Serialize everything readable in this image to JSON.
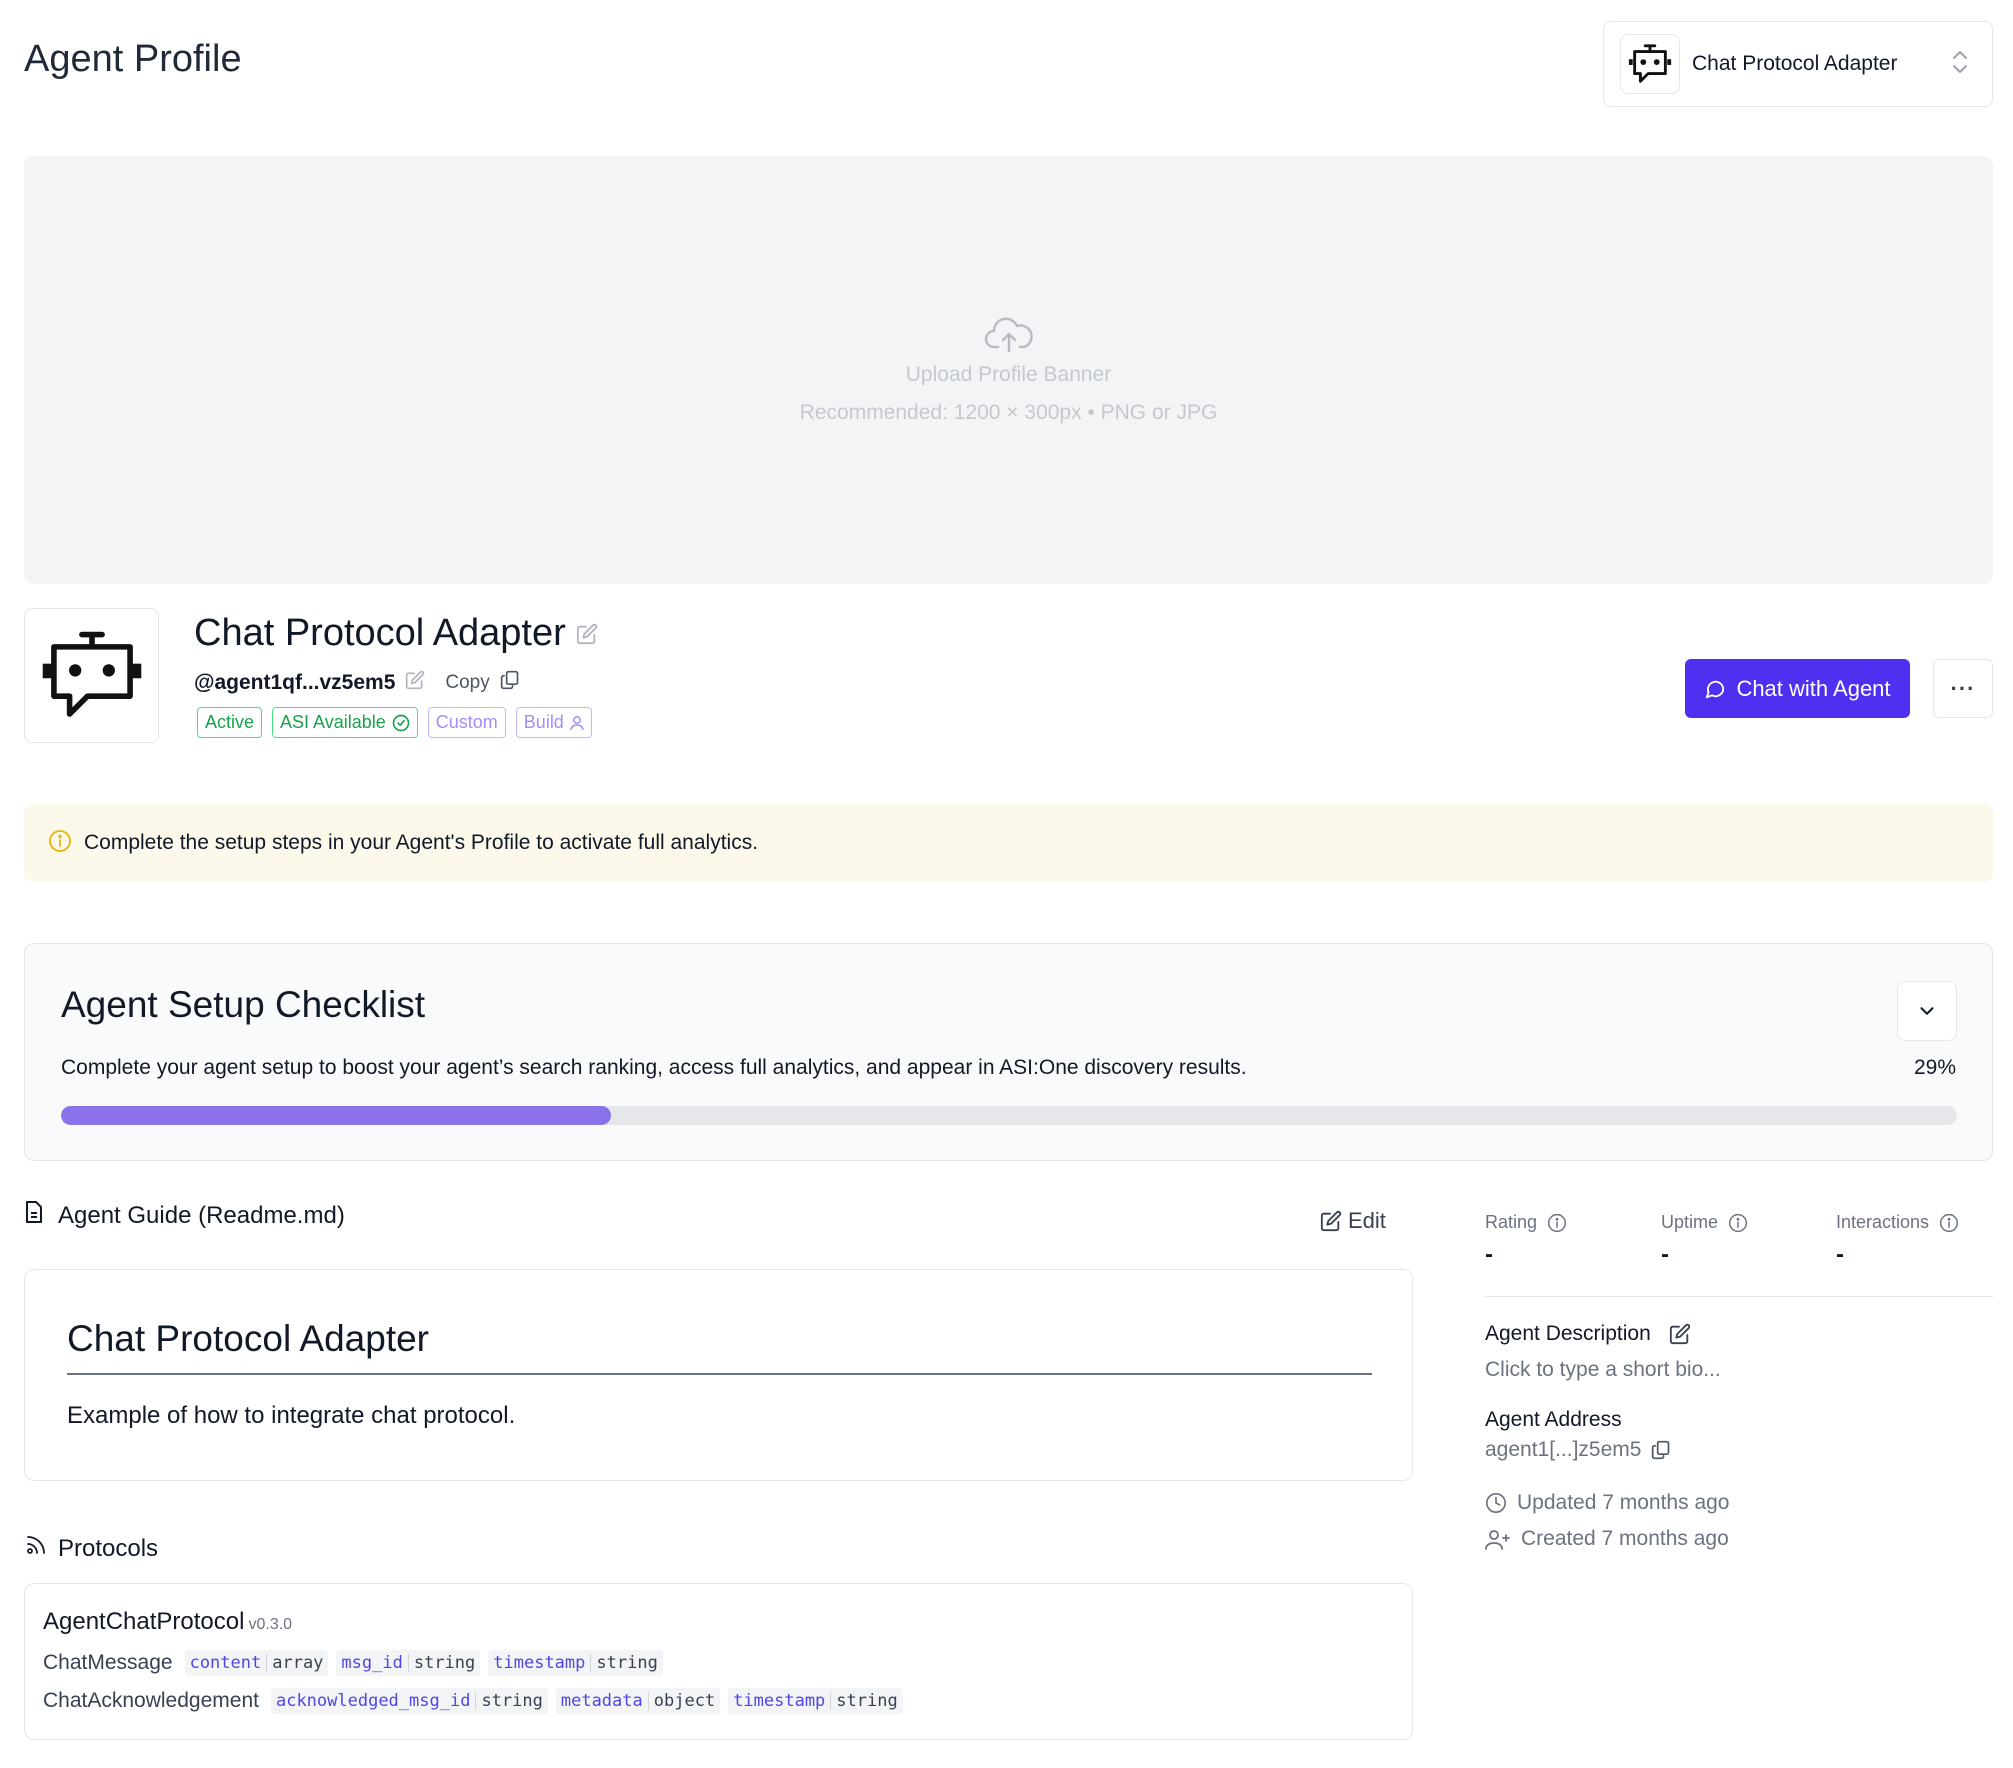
{
  "header": {
    "title": "Agent Profile",
    "agent_selector": {
      "label": "Chat Protocol Adapter",
      "icon": "robot-chat-icon"
    }
  },
  "banner": {
    "title": "Upload Profile Banner",
    "hint": "Recommended: 1200 × 300px • PNG or JPG",
    "icon": "cloud-upload-icon"
  },
  "profile": {
    "name": "Chat Protocol Adapter",
    "handle": "@agent1qf...vz5em5",
    "copy_label": "Copy",
    "badges": [
      {
        "label": "Active",
        "color": "#16a34a"
      },
      {
        "label": "ASI Available",
        "color": "#16a34a"
      },
      {
        "label": "Custom",
        "color": "#a78bfa"
      },
      {
        "label": "Build",
        "color": "#a78bfa"
      }
    ],
    "chat_button": "Chat with Agent",
    "more_button": "···"
  },
  "notice": {
    "text": "Complete the setup steps in your Agent's Profile to activate full analytics.",
    "color": "#fdf9ea"
  },
  "checklist": {
    "title": "Agent Setup Checklist",
    "description": "Complete your agent setup to boost your agent’s search ranking, access full analytics, and appear in ASI:One discovery results.",
    "percent_label": "29%",
    "progress": 0.29,
    "accent": "#8b72ea"
  },
  "guide": {
    "title": "Agent Guide (Readme.md)",
    "edit_label": "Edit",
    "heading": "Chat Protocol Adapter",
    "body": "Example of how to integrate chat protocol."
  },
  "protocols": {
    "title": "Protocols",
    "items": [
      {
        "name": "AgentChatProtocol",
        "version": "v0.3.0",
        "messages": [
          {
            "name": "ChatMessage",
            "fields": [
              {
                "key": "content",
                "type": "array"
              },
              {
                "key": "msg_id",
                "type": "string"
              },
              {
                "key": "timestamp",
                "type": "string"
              }
            ]
          },
          {
            "name": "ChatAcknowledgement",
            "fields": [
              {
                "key": "acknowledged_msg_id",
                "type": "string"
              },
              {
                "key": "metadata",
                "type": "object"
              },
              {
                "key": "timestamp",
                "type": "string"
              }
            ]
          }
        ]
      }
    ]
  },
  "sidebar": {
    "stats": [
      {
        "label": "Rating",
        "value": "-"
      },
      {
        "label": "Uptime",
        "value": "-"
      },
      {
        "label": "Interactions",
        "value": "-"
      }
    ],
    "description_label": "Agent Description",
    "description_placeholder": "Click to type a short bio...",
    "address_label": "Agent Address",
    "address_value": "agent1[...]z5em5",
    "updated": "Updated 7 months ago",
    "created": "Created 7 months ago"
  },
  "brand_color": "#4f2ff0"
}
